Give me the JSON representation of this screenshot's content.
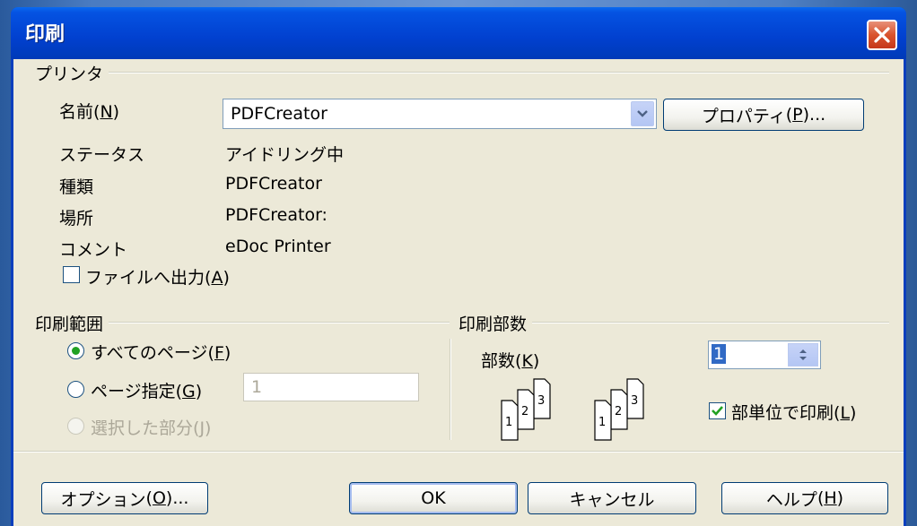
{
  "title": "印刷",
  "printer": {
    "group_label": "プリンタ",
    "name_label": "名前",
    "name_key": "N",
    "name_value": "PDFCreator",
    "properties_label": "プロパティ",
    "properties_key": "P",
    "properties_suffix": "...",
    "status_label": "ステータス",
    "status_value": "アイドリング中",
    "type_label": "種類",
    "type_value": "PDFCreator",
    "location_label": "場所",
    "location_value": "PDFCreator:",
    "comment_label": "コメント",
    "comment_value": "eDoc Printer",
    "file_output_label": "ファイルへ出力",
    "file_output_key": "A",
    "file_output_checked": false
  },
  "range": {
    "group_label": "印刷範囲",
    "all_label": "すべてのページ",
    "all_key": "F",
    "pages_label": "ページ指定",
    "pages_key": "G",
    "pages_value": "1",
    "selection_label": "選択した部分",
    "selection_key": "J",
    "selected": "all"
  },
  "copies": {
    "group_label": "印刷部数",
    "count_label": "部数",
    "count_key": "K",
    "count_value": "1",
    "collate_label": "部単位で印刷",
    "collate_key": "L",
    "collate_checked": true
  },
  "buttons": {
    "options_label": "オプション",
    "options_key": "O",
    "options_suffix": "...",
    "ok_label": "OK",
    "cancel_label": "キャンセル",
    "help_label": "ヘルプ",
    "help_key": "H"
  },
  "colors": {
    "titlebar": "#0553e2",
    "close": "#d9532d",
    "face": "#ece9d8",
    "radio_dot": "#21a121",
    "check": "#21a121"
  }
}
